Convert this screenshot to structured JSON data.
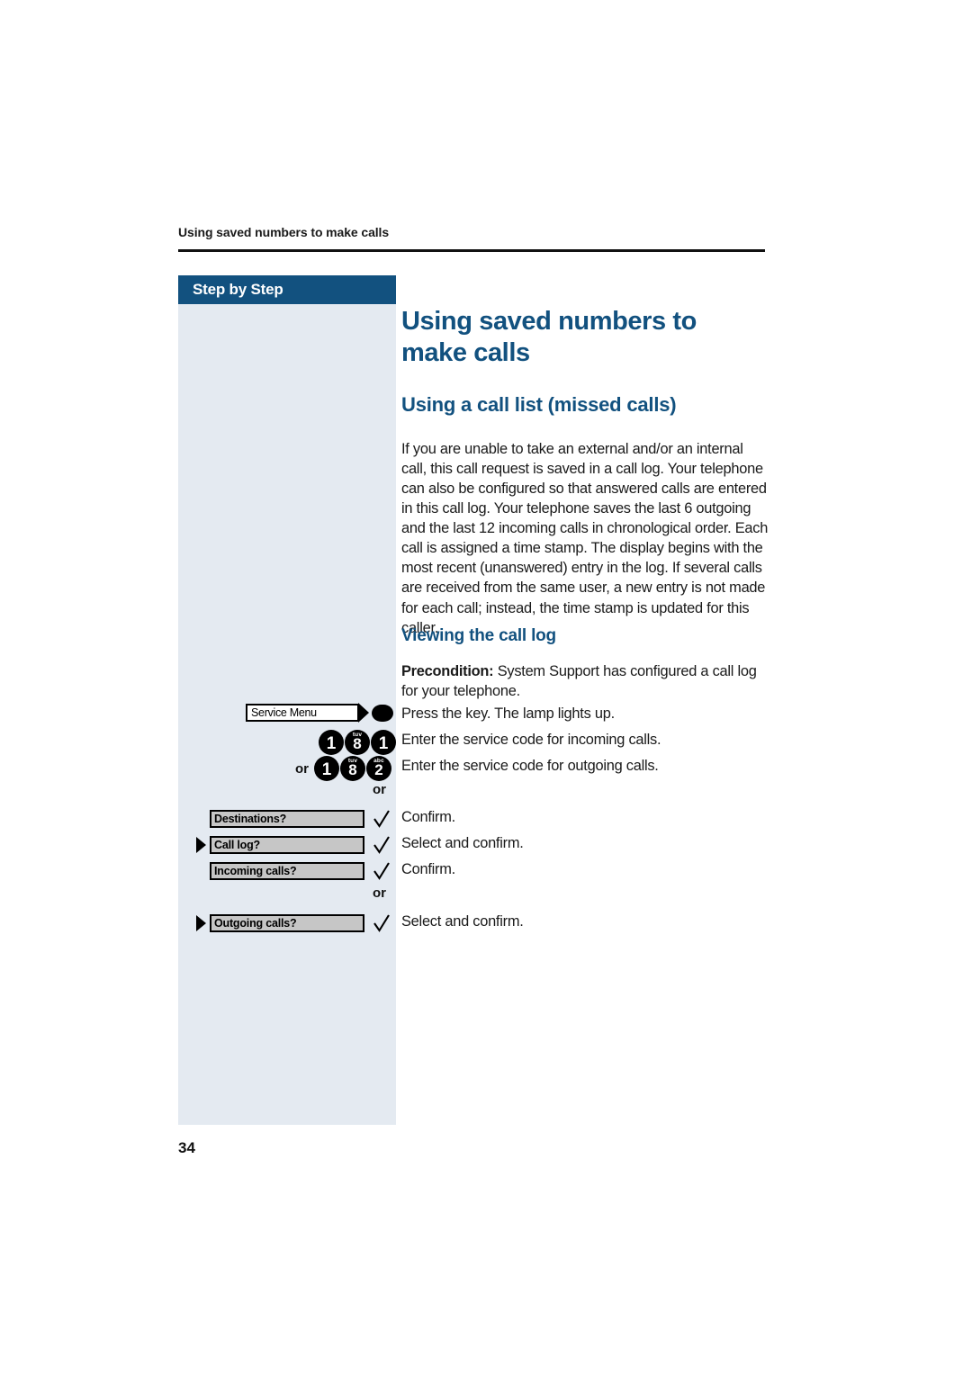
{
  "page": {
    "running_header": "Using saved numbers to make calls",
    "page_number": "34",
    "accent_color": "#12517f",
    "sidebar_color": "#e4eaf1"
  },
  "sidebar": {
    "title": "Step by Step"
  },
  "main": {
    "h1": "Using saved numbers to make calls",
    "h2": "Using a call list (missed calls)",
    "intro_paragraph": "If you are unable to take an external and/or an internal call, this call request is saved in a call log. Your telephone can also be configured so that answered calls are entered in this call log. Your telephone saves the last 6 outgoing and the last 12 incoming calls in chronological order. Each call is assigned a time stamp. The display begins with the most recent (unanswered) entry in the log. If several calls are received from the same user, a new entry is not made for each call; instead, the time stamp is updated for this caller.",
    "h3": "Viewing the call log",
    "precondition_label": "Precondition:",
    "precondition_text": " System Support has configured a call log for your telephone."
  },
  "steps": {
    "service_menu": {
      "key_label": "Service Menu",
      "description": "Press the key. The lamp lights up."
    },
    "code_incoming": {
      "keys": [
        {
          "digit": "1",
          "letters": ""
        },
        {
          "digit": "8",
          "letters": "tuv"
        },
        {
          "digit": "1",
          "letters": ""
        }
      ],
      "description": "Enter the service code for incoming calls."
    },
    "code_outgoing": {
      "or_prefix": "or",
      "keys": [
        {
          "digit": "1",
          "letters": ""
        },
        {
          "digit": "8",
          "letters": "tuv"
        },
        {
          "digit": "2",
          "letters": "abc"
        }
      ],
      "description": "Enter the service code for outgoing calls."
    },
    "or_marker_1": "or",
    "or_marker_2": "or",
    "menu_rows": [
      {
        "label": "Destinations?",
        "has_arrow": false,
        "description": "Confirm."
      },
      {
        "label": "Call log?",
        "has_arrow": true,
        "description": "Select and confirm."
      },
      {
        "label": "Incoming calls?",
        "has_arrow": false,
        "description": "Confirm."
      },
      {
        "label": "Outgoing calls?",
        "has_arrow": true,
        "description": "Select and confirm."
      }
    ]
  }
}
